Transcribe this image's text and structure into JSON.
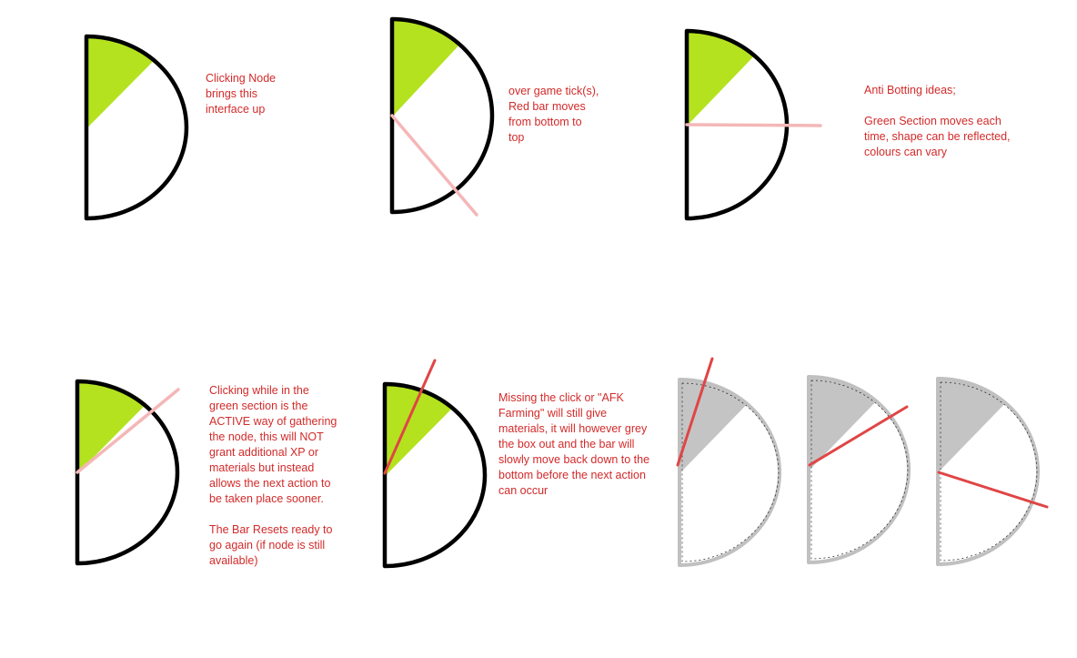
{
  "notes": {
    "clicking_node": "Clicking Node\nbrings this\ninterface up",
    "game_tick": "over game tick(s),\nRed bar moves\nfrom bottom to\ntop",
    "anti_botting": "Anti Botting ideas;\n\nGreen Section moves each\ntime, shape can be reflected,\ncolours can vary",
    "active_click": "Clicking while in the\ngreen section is the\nACTIVE way of gathering\nthe node, this will NOT\ngrant additional XP or\nmaterials but instead\nallows the next action to\nbe taken place sooner.\n\nThe Bar Resets ready to\ngo again (if node is still\navailable)",
    "missing_click": "Missing the click or \"AFK\nFarming\" will still give\nmaterials, it will however grey\nthe box out and the bar will\nslowly move back down to the\nbottom before the next action\ncan occur"
  },
  "colors": {
    "text": "#d32a2a",
    "outline_active": "#000000",
    "outline_inactive": "#c0c0c0",
    "green_section": "#b4e21f",
    "grey_section": "#c4c4c4",
    "red_bar_light": "#f4b7b7",
    "red_bar_dark": "#e04545"
  },
  "gauges": [
    {
      "name": "gauge-initial",
      "state": "active",
      "green_from_deg": 90,
      "green_to_deg": 48,
      "bar": "none"
    },
    {
      "name": "gauge-bar-moving",
      "state": "active",
      "green_from_deg": 90,
      "green_to_deg": 48,
      "bar": "light-rising"
    },
    {
      "name": "gauge-green-moves",
      "state": "active",
      "green_from_deg": 90,
      "green_to_deg": 48,
      "bar": "light-horizontal"
    },
    {
      "name": "gauge-active-click",
      "state": "active",
      "green_from_deg": 90,
      "green_to_deg": 48,
      "bar": "light-in-green"
    },
    {
      "name": "gauge-click-hit",
      "state": "active",
      "green_from_deg": 90,
      "green_to_deg": 48,
      "bar": "dark-in-green"
    },
    {
      "name": "gauge-greyed-1",
      "state": "greyed",
      "green_from_deg": 90,
      "green_to_deg": 48,
      "bar": "dark-falling"
    },
    {
      "name": "gauge-greyed-2",
      "state": "greyed",
      "green_from_deg": 90,
      "green_to_deg": 48,
      "bar": "dark-falling"
    },
    {
      "name": "gauge-greyed-3",
      "state": "greyed",
      "green_from_deg": 90,
      "green_to_deg": 48,
      "bar": "dark-falling"
    }
  ]
}
